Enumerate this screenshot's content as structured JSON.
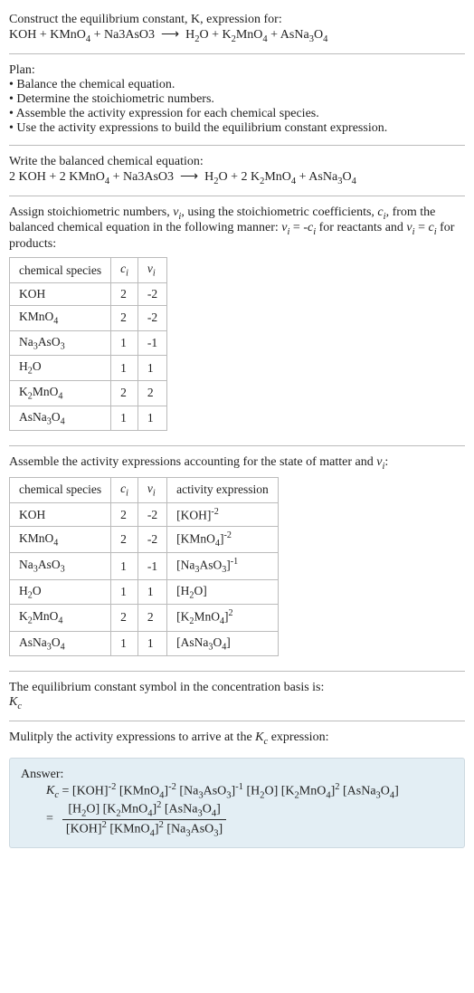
{
  "header": {
    "line1": "Construct the equilibrium constant, K, expression for:",
    "equation_html": "KOH + KMnO<sub>4</sub> + Na3AsO3 &nbsp;⟶&nbsp; H<sub>2</sub>O + K<sub>2</sub>MnO<sub>4</sub> + AsNa<sub>3</sub>O<sub>4</sub>"
  },
  "plan": {
    "title": "Plan:",
    "items": [
      "• Balance the chemical equation.",
      "• Determine the stoichiometric numbers.",
      "• Assemble the activity expression for each chemical species.",
      "• Use the activity expressions to build the equilibrium constant expression."
    ]
  },
  "balanced": {
    "title": "Write the balanced chemical equation:",
    "equation_html": "2 KOH + 2 KMnO<sub>4</sub> + Na3AsO3 &nbsp;⟶&nbsp; H<sub>2</sub>O + 2 K<sub>2</sub>MnO<sub>4</sub> + AsNa<sub>3</sub>O<sub>4</sub>"
  },
  "stoich": {
    "intro_html": "Assign stoichiometric numbers, <span class='ital'>ν<sub>i</sub></span>, using the stoichiometric coefficients, <span class='ital'>c<sub>i</sub></span>, from the balanced chemical equation in the following manner: <span class='ital'>ν<sub>i</sub></span> = -<span class='ital'>c<sub>i</sub></span> for reactants and <span class='ital'>ν<sub>i</sub></span> = <span class='ital'>c<sub>i</sub></span> for products:",
    "headers": {
      "species": "chemical species",
      "c": "c",
      "v": "ν"
    },
    "rows": [
      {
        "species_html": "KOH",
        "c": "2",
        "v": "-2"
      },
      {
        "species_html": "KMnO<sub>4</sub>",
        "c": "2",
        "v": "-2"
      },
      {
        "species_html": "Na<sub>3</sub>AsO<sub>3</sub>",
        "c": "1",
        "v": "-1"
      },
      {
        "species_html": "H<sub>2</sub>O",
        "c": "1",
        "v": "1"
      },
      {
        "species_html": "K<sub>2</sub>MnO<sub>4</sub>",
        "c": "2",
        "v": "2"
      },
      {
        "species_html": "AsNa<sub>3</sub>O<sub>4</sub>",
        "c": "1",
        "v": "1"
      }
    ]
  },
  "activity": {
    "intro_html": "Assemble the activity expressions accounting for the state of matter and <span class='ital'>ν<sub>i</sub></span>:",
    "headers": {
      "species": "chemical species",
      "c": "c",
      "v": "ν",
      "expr": "activity expression"
    },
    "rows": [
      {
        "species_html": "KOH",
        "c": "2",
        "v": "-2",
        "expr_html": "[KOH]<sup>-2</sup>"
      },
      {
        "species_html": "KMnO<sub>4</sub>",
        "c": "2",
        "v": "-2",
        "expr_html": "[KMnO<sub>4</sub>]<sup>-2</sup>"
      },
      {
        "species_html": "Na<sub>3</sub>AsO<sub>3</sub>",
        "c": "1",
        "v": "-1",
        "expr_html": "[Na<sub>3</sub>AsO<sub>3</sub>]<sup>-1</sup>"
      },
      {
        "species_html": "H<sub>2</sub>O",
        "c": "1",
        "v": "1",
        "expr_html": "[H<sub>2</sub>O]"
      },
      {
        "species_html": "K<sub>2</sub>MnO<sub>4</sub>",
        "c": "2",
        "v": "2",
        "expr_html": "[K<sub>2</sub>MnO<sub>4</sub>]<sup>2</sup>"
      },
      {
        "species_html": "AsNa<sub>3</sub>O<sub>4</sub>",
        "c": "1",
        "v": "1",
        "expr_html": "[AsNa<sub>3</sub>O<sub>4</sub>]"
      }
    ]
  },
  "symbol": {
    "line1": "The equilibrium constant symbol in the concentration basis is:",
    "line2_html": "<span class='ital'>K<sub>c</sub></span>"
  },
  "multiply": {
    "line_html": "Mulitply the activity expressions to arrive at the <span class='ital'>K<sub>c</sub></span> expression:"
  },
  "answer": {
    "label": "Answer:",
    "expr_flat_html": "<span class='ital'>K<sub>c</sub></span> = [KOH]<sup>-2</sup> [KMnO<sub>4</sub>]<sup>-2</sup> [Na<sub>3</sub>AsO<sub>3</sub>]<sup>-1</sup> [H<sub>2</sub>O] [K<sub>2</sub>MnO<sub>4</sub>]<sup>2</sup> [AsNa<sub>3</sub>O<sub>4</sub>]",
    "frac_num_html": "[H<sub>2</sub>O] [K<sub>2</sub>MnO<sub>4</sub>]<sup>2</sup> [AsNa<sub>3</sub>O<sub>4</sub>]",
    "frac_den_html": "[KOH]<sup>2</sup> [KMnO<sub>4</sub>]<sup>2</sup> [Na<sub>3</sub>AsO<sub>3</sub>]"
  }
}
